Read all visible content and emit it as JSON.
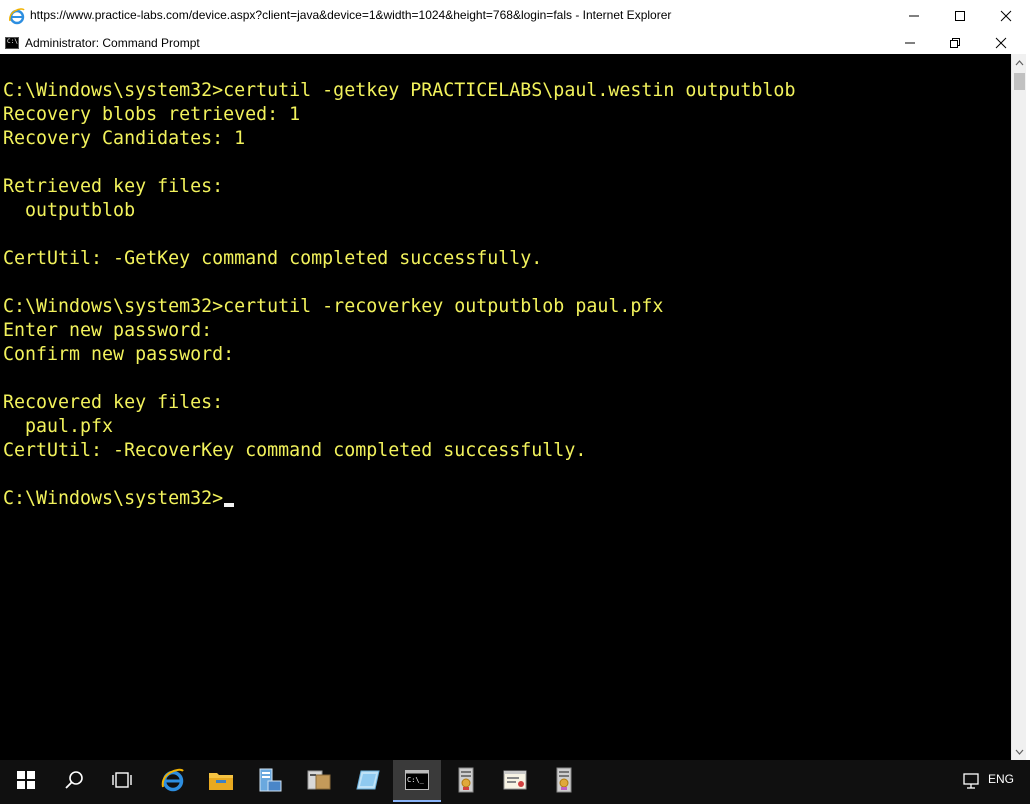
{
  "browser": {
    "title": "https://www.practice-labs.com/device.aspx?client=java&device=1&width=1024&height=768&login=fals - Internet Explorer",
    "icon": "internet-explorer-icon"
  },
  "cmd_window": {
    "title": "Administrator: Command Prompt",
    "icon": "command-prompt-icon"
  },
  "console": {
    "lines": [
      "C:\\Windows\\system32>certutil -getkey PRACTICELABS\\paul.westin outputblob",
      "Recovery blobs retrieved: 1",
      "Recovery Candidates: 1",
      "",
      "Retrieved key files:",
      "  outputblob",
      "",
      "CertUtil: -GetKey command completed successfully.",
      "",
      "C:\\Windows\\system32>certutil -recoverkey outputblob paul.pfx",
      "Enter new password:",
      "Confirm new password:",
      "",
      "Recovered key files:",
      "  paul.pfx",
      "CertUtil: -RecoverKey command completed successfully.",
      "",
      "C:\\Windows\\system32>"
    ],
    "text_color": "#f2f25c",
    "background": "#000000"
  },
  "taskbar": {
    "items": [
      "windows-start-icon",
      "search-icon",
      "task-view-icon",
      "internet-explorer-icon",
      "file-explorer-icon",
      "server-manager-icon",
      "computer-management-icon",
      "powershell-ise-icon",
      "command-prompt-icon",
      "certificate-authority-icon",
      "certificate-templates-icon",
      "certificates-icon"
    ],
    "language": "ENG"
  }
}
